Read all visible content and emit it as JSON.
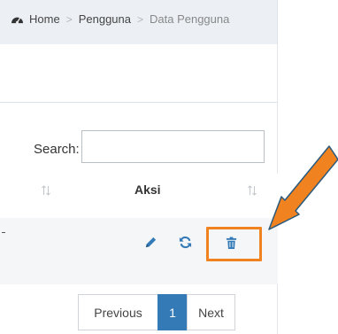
{
  "breadcrumb": {
    "home": "Home",
    "section": "Pengguna",
    "current": "Data Pengguna",
    "separator": ">"
  },
  "search": {
    "label": "Search:",
    "value": ""
  },
  "table": {
    "action_header": "Aksi",
    "row_actions": [
      "pencil-icon",
      "refresh-icon",
      "trash-icon"
    ]
  },
  "pagination": {
    "previous": "Previous",
    "current_page": "1",
    "next": "Next"
  },
  "colors": {
    "primary": "#337ab7",
    "highlight": "#f08220",
    "arrow": "#f08220"
  }
}
